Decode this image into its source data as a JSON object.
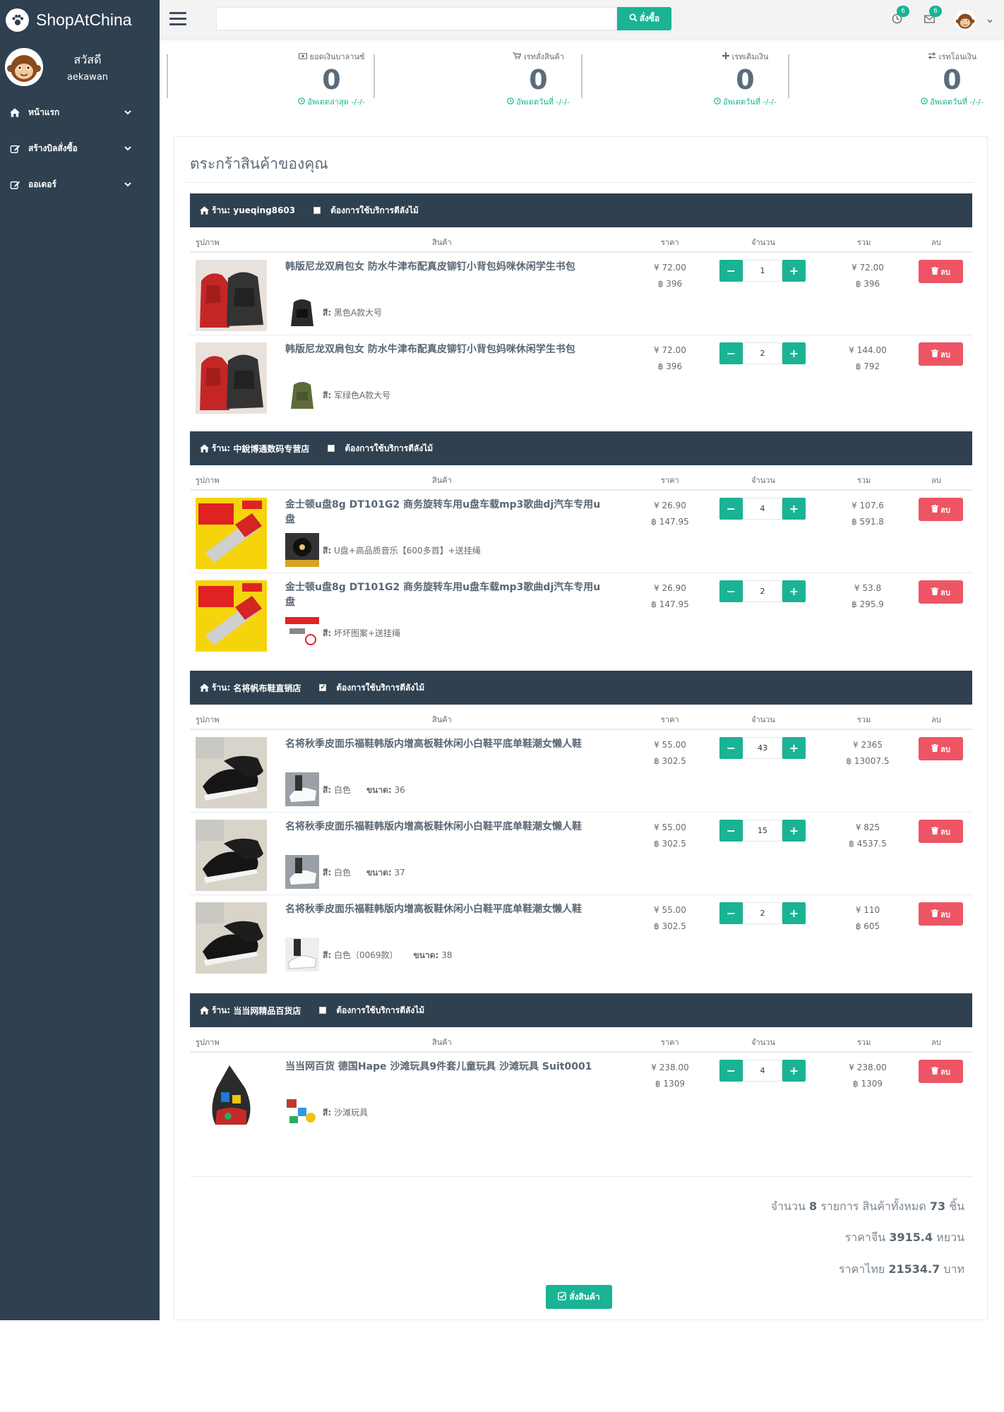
{
  "app": {
    "brand": "ShopAtChina"
  },
  "sidebar": {
    "greeting": "สวัสดี",
    "username": "aekawan",
    "items": [
      {
        "label": "หน้าแรก",
        "icon": "home-icon"
      },
      {
        "label": "สร้างบิลสั่งซื้อ",
        "icon": "edit-icon"
      },
      {
        "label": "ออเดอร์",
        "icon": "edit-icon"
      }
    ]
  },
  "topbar": {
    "search_value": "",
    "search_button": "สั่งซื้อ",
    "notify_count": "6",
    "mail_count": "6"
  },
  "stats": [
    {
      "title": "ยอดเงินบาลานซ์",
      "value": "0",
      "foot": "อัพเดตล่าสุด -/-/-"
    },
    {
      "title": "เรทสั่งสินค้า",
      "value": "0",
      "foot": "อัพเดตวันที่ -/-/-"
    },
    {
      "title": "เรทเติมเงิน",
      "value": "0",
      "foot": "อัพเดตวันที่ -/-/-"
    },
    {
      "title": "เรทโอนเงิน",
      "value": "0",
      "foot": "อัพเดตวันที่ -/-/-"
    }
  ],
  "cart": {
    "title": "ตระกร้าสินค้าของคุณ",
    "columns": {
      "image": "รูปภาพ",
      "product": "สินค้า",
      "price": "ราคา",
      "qty": "จำนวน",
      "total": "รวม",
      "delete": "ลบ"
    },
    "service_label": "ต้องการใช้บริการตีลังไม้",
    "shop_prefix": "ร้าน:",
    "color_prefix": "สี:",
    "size_prefix": "ขนาด:",
    "delete_label": "ลบ",
    "shops": [
      {
        "name": "yueqing8603",
        "service_checked": false,
        "items": [
          {
            "name": "韩版尼龙双肩包女 防水牛津布配真皮铆钉小背包妈咪休闲学生书包",
            "color": "黑色A款大号",
            "size": "",
            "price_cny": "¥ 72.00",
            "price_thb": "฿ 396",
            "qty": "1",
            "total_cny": "¥ 72.00",
            "total_thb": "฿ 396"
          },
          {
            "name": "韩版尼龙双肩包女 防水牛津布配真皮铆钉小背包妈咪休闲学生书包",
            "color": "军绿色A款大号",
            "size": "",
            "price_cny": "¥ 72.00",
            "price_thb": "฿ 396",
            "qty": "2",
            "total_cny": "¥ 144.00",
            "total_thb": "฿ 792"
          }
        ]
      },
      {
        "name": "中銳博通数码专营店",
        "service_checked": false,
        "items": [
          {
            "name": "金士顿u盘8g DT101G2 商务旋转车用u盘车载mp3歌曲dj汽车专用u盘",
            "color": "U盘+高品质音乐【600多首】+送挂绳",
            "size": "",
            "price_cny": "¥ 26.90",
            "price_thb": "฿ 147.95",
            "qty": "4",
            "total_cny": "¥ 107.6",
            "total_thb": "฿ 591.8"
          },
          {
            "name": "金士顿u盘8g DT101G2 商务旋转车用u盘车载mp3歌曲dj汽车专用u盘",
            "color": "坏坏图案+送挂绳",
            "size": "",
            "price_cny": "¥ 26.90",
            "price_thb": "฿ 147.95",
            "qty": "2",
            "total_cny": "¥ 53.8",
            "total_thb": "฿ 295.9"
          }
        ]
      },
      {
        "name": "名将帆布鞋直销店",
        "service_checked": true,
        "items": [
          {
            "name": "名将秋季皮面乐福鞋韩版内增高板鞋休闲小白鞋平底单鞋潮女懒人鞋",
            "color": "白色",
            "size": "36",
            "price_cny": "¥ 55.00",
            "price_thb": "฿ 302.5",
            "qty": "43",
            "total_cny": "¥ 2365",
            "total_thb": "฿ 13007.5"
          },
          {
            "name": "名将秋季皮面乐福鞋韩版内增高板鞋休闲小白鞋平底单鞋潮女懒人鞋",
            "color": "白色",
            "size": "37",
            "price_cny": "¥ 55.00",
            "price_thb": "฿ 302.5",
            "qty": "15",
            "total_cny": "¥ 825",
            "total_thb": "฿ 4537.5"
          },
          {
            "name": "名将秋季皮面乐福鞋韩版内增高板鞋休闲小白鞋平底单鞋潮女懒人鞋",
            "color": "白色（0069款）",
            "size": "38",
            "price_cny": "¥ 55.00",
            "price_thb": "฿ 302.5",
            "qty": "2",
            "total_cny": "¥ 110",
            "total_thb": "฿ 605"
          }
        ]
      },
      {
        "name": "当当网精品百货店",
        "service_checked": false,
        "items": [
          {
            "name": "当当网百货 德国Hape 沙滩玩具9件套儿童玩具 沙滩玩具 Suit0001",
            "color": "沙滩玩具",
            "size": "",
            "price_cny": "¥ 238.00",
            "price_thb": "฿ 1309",
            "qty": "4",
            "total_cny": "¥ 238.00",
            "total_thb": "฿ 1309"
          }
        ]
      }
    ],
    "summary": {
      "count_label_a": "จำนวน",
      "count_items": "8",
      "count_label_b": "รายการ สินค้าทั้งหมด",
      "count_pieces": "73",
      "count_label_c": "ชิ้น",
      "cny_label": "ราคาจีน",
      "cny_value": "3915.4",
      "cny_unit": "หยวน",
      "thb_label": "ราคาไทย",
      "thb_value": "21534.7",
      "thb_unit": "บาท"
    },
    "order_button": "สั่งสินค้า"
  },
  "colors": {
    "sidebar": "#2f4050",
    "accent": "#1ab394",
    "danger": "#ed5565"
  }
}
